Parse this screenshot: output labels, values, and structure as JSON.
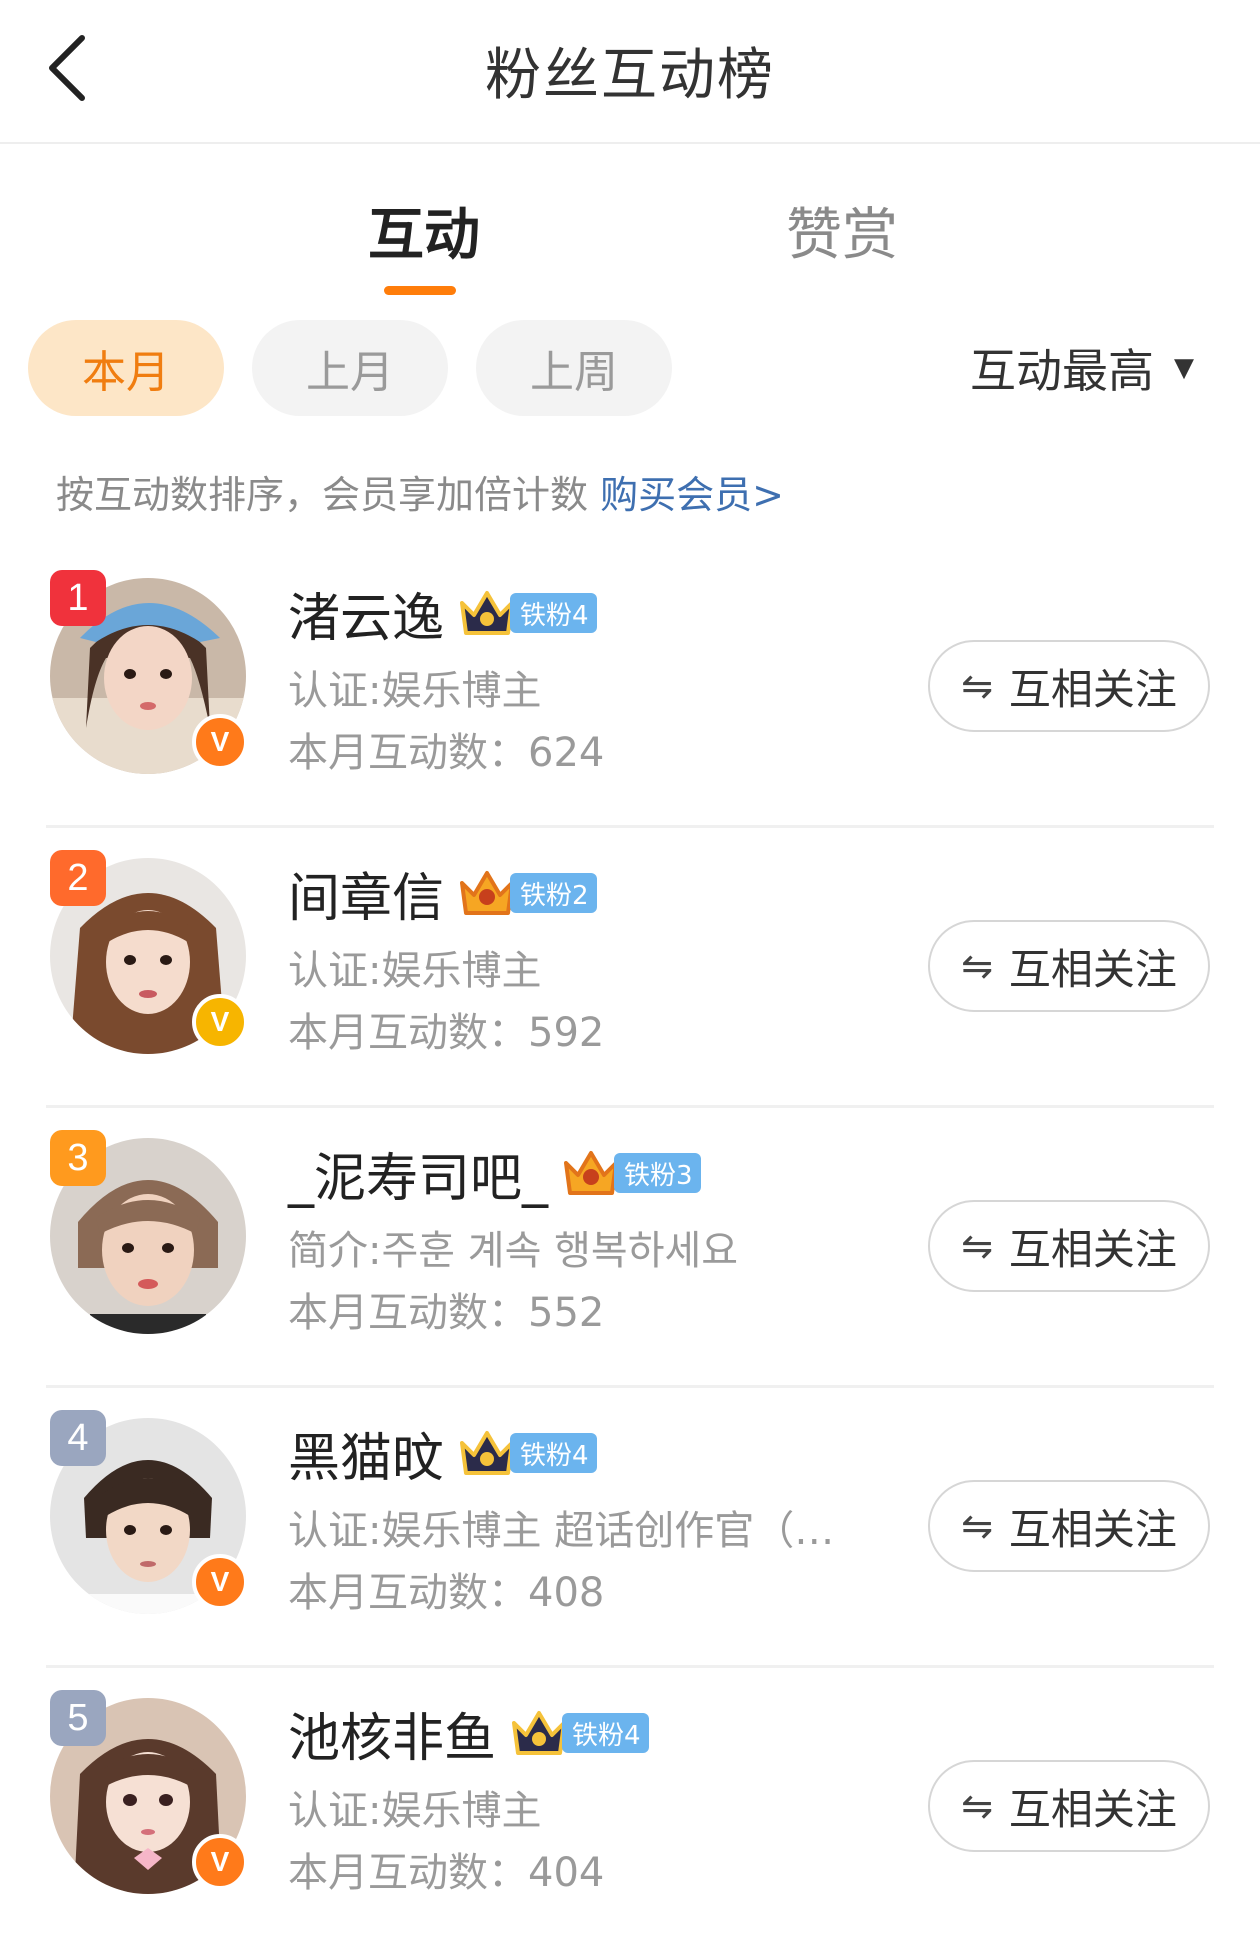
{
  "header": {
    "title": "粉丝互动榜"
  },
  "tabs": [
    {
      "label": "互动"
    },
    {
      "label": "赞赏"
    }
  ],
  "periods": [
    {
      "label": "本月"
    },
    {
      "label": "上月"
    },
    {
      "label": "上周"
    }
  ],
  "sort": {
    "label": "互动最高"
  },
  "hint": {
    "text": "按互动数排序，会员享加倍计数 ",
    "link": "购买会员>"
  },
  "colors": {
    "accent": "#ff7d0a",
    "link": "#3e6fb0",
    "fan_badge": "#6bb4ee"
  },
  "users": [
    {
      "rank": "1",
      "name": "渚云逸",
      "fan_level": "铁粉4",
      "desc": "认证:娱乐博主",
      "count_label": "本月互动数：",
      "count": "624",
      "verified": "V",
      "follow": "互相关注"
    },
    {
      "rank": "2",
      "name": "间章信",
      "fan_level": "铁粉2",
      "desc": "认证:娱乐博主",
      "count_label": "本月互动数：",
      "count": "592",
      "verified": "V",
      "follow": "互相关注"
    },
    {
      "rank": "3",
      "name": "_泥寿司吧_",
      "fan_level": "铁粉3",
      "desc": "简介:주훈 계속 행복하세요",
      "count_label": "本月互动数：",
      "count": "552",
      "verified": "",
      "follow": "互相关注"
    },
    {
      "rank": "4",
      "name": "黑猫旼",
      "fan_level": "铁粉4",
      "desc": "认证:娱乐博主 超话创作官（…",
      "count_label": "本月互动数：",
      "count": "408",
      "verified": "V",
      "follow": "互相关注"
    },
    {
      "rank": "5",
      "name": "池核非鱼",
      "fan_level": "铁粉4",
      "desc": "认证:娱乐博主",
      "count_label": "本月互动数：",
      "count": "404",
      "verified": "V",
      "follow": "互相关注"
    }
  ]
}
